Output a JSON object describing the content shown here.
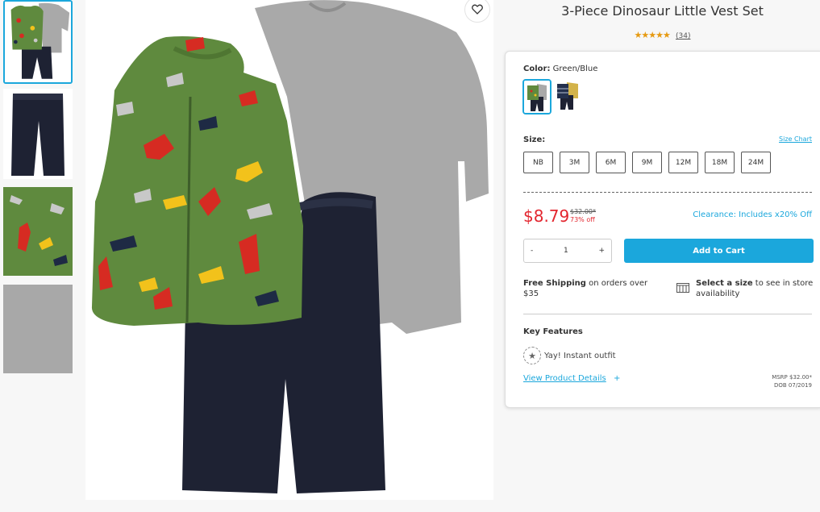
{
  "product": {
    "title": "3-Piece Dinosaur Little Vest Set",
    "stars": "★★★★★",
    "review_count": "(34)",
    "rating_value": 5
  },
  "thumbnails": [
    {
      "name": "outfit-front"
    },
    {
      "name": "pants"
    },
    {
      "name": "vest-detail"
    },
    {
      "name": "bodysuit-fabric"
    }
  ],
  "color": {
    "label": "Color:",
    "value": "Green/Blue",
    "swatches": [
      "green-blue",
      "navy-yellow"
    ]
  },
  "size": {
    "label": "Size:",
    "chart_link": "Size Chart",
    "options": [
      "NB",
      "3M",
      "6M",
      "9M",
      "12M",
      "18M",
      "24M"
    ]
  },
  "pricing": {
    "price": "$8.79",
    "original": "$32.00*",
    "discount": "73% off",
    "clearance": "Clearance: Includes x20% Off"
  },
  "quantity": {
    "minus": "-",
    "value": "1",
    "plus": "+"
  },
  "cart": {
    "add_label": "Add to Cart"
  },
  "shipping": {
    "bold": "Free Shipping",
    "rest": " on orders over $35"
  },
  "store": {
    "bold": "Select a size",
    "rest": " to see in store availability"
  },
  "key_features": {
    "title": "Key Features",
    "item": "Yay! Instant outfit"
  },
  "details": {
    "link": "View Product Details",
    "plus": "+",
    "msrp_line": "MSRP $32.00*",
    "dob_line": "DOB 07/2019"
  },
  "colors": {
    "accent": "#1ba7dc",
    "price_red": "#e3262f",
    "star": "#e69a12",
    "vest_green": "#5f8a3e",
    "denim": "#1e2233",
    "heather_gray": "#a9a9a9"
  }
}
